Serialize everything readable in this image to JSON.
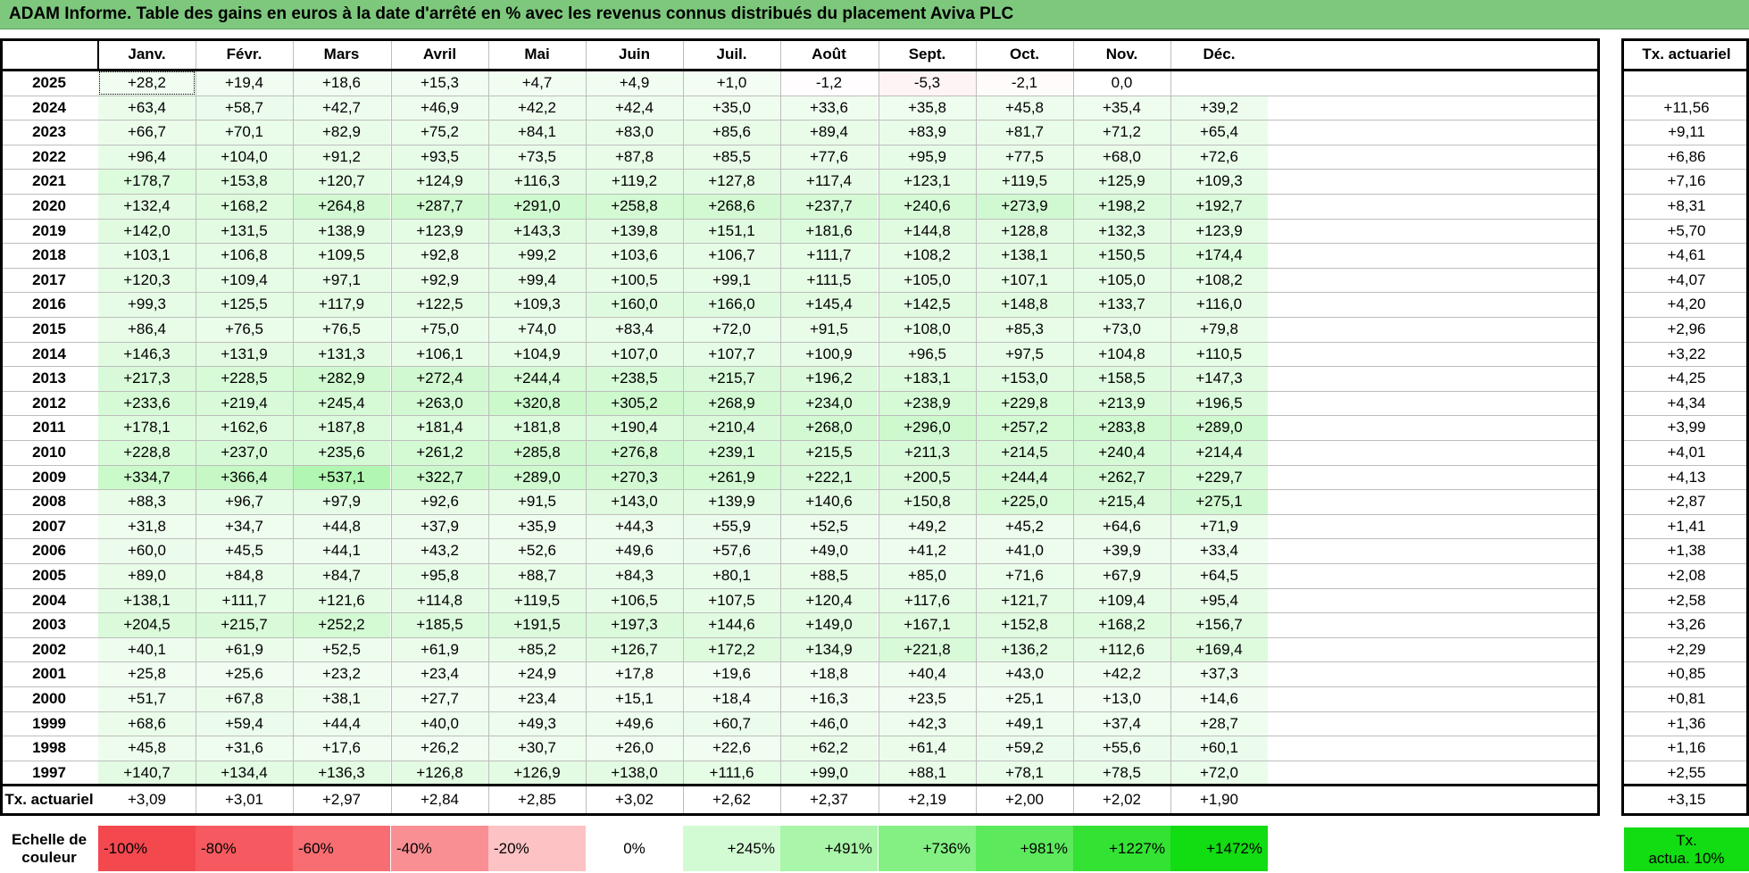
{
  "title": "ADAM Informe. Table des gains en euros à la date d'arrêté en % avec les revenus connus distribués du placement Aviva PLC",
  "months": [
    "Janv.",
    "Févr.",
    "Mars",
    "Avril",
    "Mai",
    "Juin",
    "Juil.",
    "Août",
    "Sept.",
    "Oct.",
    "Nov.",
    "Déc."
  ],
  "rate_header": "Tx. actuariel",
  "rows": [
    {
      "year": "2025",
      "values": [
        "+28,2",
        "+19,4",
        "+18,6",
        "+15,3",
        "+4,7",
        "+4,9",
        "+1,0",
        "-1,2",
        "-5,3",
        "-2,1",
        "0,0",
        ""
      ],
      "rate": ""
    },
    {
      "year": "2024",
      "values": [
        "+63,4",
        "+58,7",
        "+42,7",
        "+46,9",
        "+42,2",
        "+42,4",
        "+35,0",
        "+33,6",
        "+35,8",
        "+45,8",
        "+35,4",
        "+39,2"
      ],
      "rate": "+11,56"
    },
    {
      "year": "2023",
      "values": [
        "+66,7",
        "+70,1",
        "+82,9",
        "+75,2",
        "+84,1",
        "+83,0",
        "+85,6",
        "+89,4",
        "+83,9",
        "+81,7",
        "+71,2",
        "+65,4"
      ],
      "rate": "+9,11"
    },
    {
      "year": "2022",
      "values": [
        "+96,4",
        "+104,0",
        "+91,2",
        "+93,5",
        "+73,5",
        "+87,8",
        "+85,5",
        "+77,6",
        "+95,9",
        "+77,5",
        "+68,0",
        "+72,6"
      ],
      "rate": "+6,86"
    },
    {
      "year": "2021",
      "values": [
        "+178,7",
        "+153,8",
        "+120,7",
        "+124,9",
        "+116,3",
        "+119,2",
        "+127,8",
        "+117,4",
        "+123,1",
        "+119,5",
        "+125,9",
        "+109,3"
      ],
      "rate": "+7,16"
    },
    {
      "year": "2020",
      "values": [
        "+132,4",
        "+168,2",
        "+264,8",
        "+287,7",
        "+291,0",
        "+258,8",
        "+268,6",
        "+237,7",
        "+240,6",
        "+273,9",
        "+198,2",
        "+192,7"
      ],
      "rate": "+8,31"
    },
    {
      "year": "2019",
      "values": [
        "+142,0",
        "+131,5",
        "+138,9",
        "+123,9",
        "+143,3",
        "+139,8",
        "+151,1",
        "+181,6",
        "+144,8",
        "+128,8",
        "+132,3",
        "+123,9"
      ],
      "rate": "+5,70"
    },
    {
      "year": "2018",
      "values": [
        "+103,1",
        "+106,8",
        "+109,5",
        "+92,8",
        "+99,2",
        "+103,6",
        "+106,7",
        "+111,7",
        "+108,2",
        "+138,1",
        "+150,5",
        "+174,4"
      ],
      "rate": "+4,61"
    },
    {
      "year": "2017",
      "values": [
        "+120,3",
        "+109,4",
        "+97,1",
        "+92,9",
        "+99,4",
        "+100,5",
        "+99,1",
        "+111,5",
        "+105,0",
        "+107,1",
        "+105,0",
        "+108,2"
      ],
      "rate": "+4,07"
    },
    {
      "year": "2016",
      "values": [
        "+99,3",
        "+125,5",
        "+117,9",
        "+122,5",
        "+109,3",
        "+160,0",
        "+166,0",
        "+145,4",
        "+142,5",
        "+148,8",
        "+133,7",
        "+116,0"
      ],
      "rate": "+4,20"
    },
    {
      "year": "2015",
      "values": [
        "+86,4",
        "+76,5",
        "+76,5",
        "+75,0",
        "+74,0",
        "+83,4",
        "+72,0",
        "+91,5",
        "+108,0",
        "+85,3",
        "+73,0",
        "+79,8"
      ],
      "rate": "+2,96"
    },
    {
      "year": "2014",
      "values": [
        "+146,3",
        "+131,9",
        "+131,3",
        "+106,1",
        "+104,9",
        "+107,0",
        "+107,7",
        "+100,9",
        "+96,5",
        "+97,5",
        "+104,8",
        "+110,5"
      ],
      "rate": "+3,22"
    },
    {
      "year": "2013",
      "values": [
        "+217,3",
        "+228,5",
        "+282,9",
        "+272,4",
        "+244,4",
        "+238,5",
        "+215,7",
        "+196,2",
        "+183,1",
        "+153,0",
        "+158,5",
        "+147,3"
      ],
      "rate": "+4,25"
    },
    {
      "year": "2012",
      "values": [
        "+233,6",
        "+219,4",
        "+245,4",
        "+263,0",
        "+320,8",
        "+305,2",
        "+268,9",
        "+234,0",
        "+238,9",
        "+229,8",
        "+213,9",
        "+196,5"
      ],
      "rate": "+4,34"
    },
    {
      "year": "2011",
      "values": [
        "+178,1",
        "+162,6",
        "+187,8",
        "+181,4",
        "+181,8",
        "+190,4",
        "+210,4",
        "+268,0",
        "+296,0",
        "+257,2",
        "+283,8",
        "+289,0"
      ],
      "rate": "+3,99"
    },
    {
      "year": "2010",
      "values": [
        "+228,8",
        "+237,0",
        "+235,6",
        "+261,2",
        "+285,8",
        "+276,8",
        "+239,1",
        "+215,5",
        "+211,3",
        "+214,5",
        "+240,4",
        "+214,4"
      ],
      "rate": "+4,01"
    },
    {
      "year": "2009",
      "values": [
        "+334,7",
        "+366,4",
        "+537,1",
        "+322,7",
        "+289,0",
        "+270,3",
        "+261,9",
        "+222,1",
        "+200,5",
        "+244,4",
        "+262,7",
        "+229,7"
      ],
      "rate": "+4,13"
    },
    {
      "year": "2008",
      "values": [
        "+88,3",
        "+96,7",
        "+97,9",
        "+92,6",
        "+91,5",
        "+143,0",
        "+139,9",
        "+140,6",
        "+150,8",
        "+225,0",
        "+215,4",
        "+275,1"
      ],
      "rate": "+2,87"
    },
    {
      "year": "2007",
      "values": [
        "+31,8",
        "+34,7",
        "+44,8",
        "+37,9",
        "+35,9",
        "+44,3",
        "+55,9",
        "+52,5",
        "+49,2",
        "+45,2",
        "+64,6",
        "+71,9"
      ],
      "rate": "+1,41"
    },
    {
      "year": "2006",
      "values": [
        "+60,0",
        "+45,5",
        "+44,1",
        "+43,2",
        "+52,6",
        "+49,6",
        "+57,6",
        "+49,0",
        "+41,2",
        "+41,0",
        "+39,9",
        "+33,4"
      ],
      "rate": "+1,38"
    },
    {
      "year": "2005",
      "values": [
        "+89,0",
        "+84,8",
        "+84,7",
        "+95,8",
        "+88,7",
        "+84,3",
        "+80,1",
        "+88,5",
        "+85,0",
        "+71,6",
        "+67,9",
        "+64,5"
      ],
      "rate": "+2,08"
    },
    {
      "year": "2004",
      "values": [
        "+138,1",
        "+111,7",
        "+121,6",
        "+114,8",
        "+119,5",
        "+106,5",
        "+107,5",
        "+120,4",
        "+117,6",
        "+121,7",
        "+109,4",
        "+95,4"
      ],
      "rate": "+2,58"
    },
    {
      "year": "2003",
      "values": [
        "+204,5",
        "+215,7",
        "+252,2",
        "+185,5",
        "+191,5",
        "+197,3",
        "+144,6",
        "+149,0",
        "+167,1",
        "+152,8",
        "+168,2",
        "+156,7"
      ],
      "rate": "+3,26"
    },
    {
      "year": "2002",
      "values": [
        "+40,1",
        "+61,9",
        "+52,5",
        "+61,9",
        "+85,2",
        "+126,7",
        "+172,2",
        "+134,9",
        "+221,8",
        "+136,2",
        "+112,6",
        "+169,4"
      ],
      "rate": "+2,29"
    },
    {
      "year": "2001",
      "values": [
        "+25,8",
        "+25,6",
        "+23,2",
        "+23,4",
        "+24,9",
        "+17,8",
        "+19,6",
        "+18,8",
        "+40,4",
        "+43,0",
        "+42,2",
        "+37,3"
      ],
      "rate": "+0,85"
    },
    {
      "year": "2000",
      "values": [
        "+51,7",
        "+67,8",
        "+38,1",
        "+27,7",
        "+23,4",
        "+15,1",
        "+18,4",
        "+16,3",
        "+23,5",
        "+25,1",
        "+13,0",
        "+14,6"
      ],
      "rate": "+0,81"
    },
    {
      "year": "1999",
      "values": [
        "+68,6",
        "+59,4",
        "+44,4",
        "+40,0",
        "+49,3",
        "+49,6",
        "+60,7",
        "+46,0",
        "+42,3",
        "+49,1",
        "+37,4",
        "+28,7"
      ],
      "rate": "+1,36"
    },
    {
      "year": "1998",
      "values": [
        "+45,8",
        "+31,6",
        "+17,6",
        "+26,2",
        "+30,7",
        "+26,0",
        "+22,6",
        "+62,2",
        "+61,4",
        "+59,2",
        "+55,6",
        "+60,1"
      ],
      "rate": "+1,16"
    },
    {
      "year": "1997",
      "values": [
        "+140,7",
        "+134,4",
        "+136,3",
        "+126,8",
        "+126,9",
        "+138,0",
        "+111,6",
        "+99,0",
        "+88,1",
        "+78,1",
        "+78,5",
        "+72,0"
      ],
      "rate": "+2,55"
    }
  ],
  "summary": {
    "label": "Tx. actuariel",
    "values": [
      "+3,09",
      "+3,01",
      "+2,97",
      "+2,84",
      "+2,85",
      "+3,02",
      "+2,62",
      "+2,37",
      "+2,19",
      "+2,00",
      "+2,02",
      "+1,90"
    ],
    "rate": "+3,15"
  },
  "scale": {
    "label_line1": "Echelle de",
    "label_line2": "couleur",
    "items": [
      {
        "text": "-100%",
        "color": "#f4484f",
        "align": "left"
      },
      {
        "text": "-80%",
        "color": "#f65a60",
        "align": "left"
      },
      {
        "text": "-60%",
        "color": "#f76d72",
        "align": "left"
      },
      {
        "text": "-40%",
        "color": "#f98f93",
        "align": "left"
      },
      {
        "text": "-20%",
        "color": "#fcc2c4",
        "align": "left"
      },
      {
        "text": "0%",
        "color": "#ffffff",
        "align": "center"
      },
      {
        "text": "+245%",
        "color": "#d3fbd3",
        "align": "right"
      },
      {
        "text": "+491%",
        "color": "#a9f5a9",
        "align": "right"
      },
      {
        "text": "+736%",
        "color": "#84f084",
        "align": "right"
      },
      {
        "text": "+981%",
        "color": "#5ce95c",
        "align": "right"
      },
      {
        "text": "+1227%",
        "color": "#34e234",
        "align": "right"
      },
      {
        "text": "+1472%",
        "color": "#12dc12",
        "align": "right"
      }
    ],
    "rate_line1": "Tx.",
    "rate_line2": "actua. 10%",
    "rate_color": "#12dc12"
  },
  "colors": {
    "title_bg": "#7dc87d",
    "positive_max": "#12dc12",
    "negative_max": "#f4484f"
  }
}
